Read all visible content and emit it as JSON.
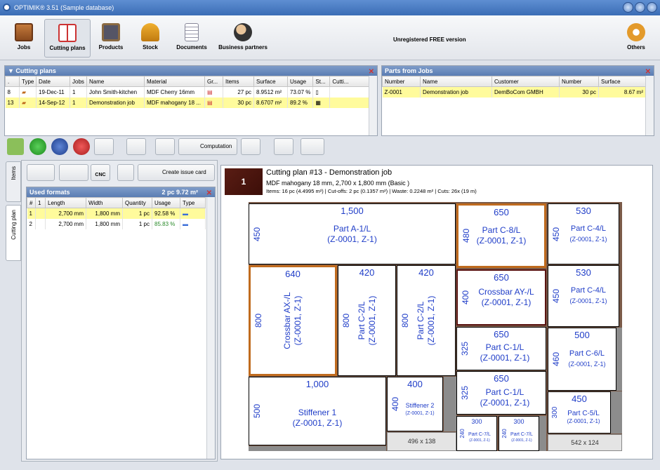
{
  "app": {
    "title": "OPTIMIK® 3.51 (Sample database)"
  },
  "toolbar": {
    "items": [
      {
        "label": "Jobs",
        "icon": "shelf-icon"
      },
      {
        "label": "Cutting plans",
        "icon": "cutting-plan-icon"
      },
      {
        "label": "Products",
        "icon": "cabinet-icon"
      },
      {
        "label": "Stock",
        "icon": "forklift-icon"
      },
      {
        "label": "Documents",
        "icon": "document-icon"
      },
      {
        "label": "Business partners",
        "icon": "people-icon"
      }
    ],
    "unregistered": "Unregistered FREE version",
    "others": "Others"
  },
  "cutting_plans": {
    "title": "Cutting plans",
    "headers": [
      ".",
      "Type",
      "Date",
      "Jobs",
      "Name",
      "Material",
      "Gr...",
      "Items",
      "Surface",
      "Usage",
      "St...",
      "Cutti..."
    ],
    "rows": [
      {
        "id": "8",
        "date": "19-Dec-11",
        "jobs": "1",
        "name": "John Smith-kitchen",
        "material": "MDF Cherry 16mm",
        "items": "27 pc",
        "surface": "8.9512 m²",
        "usage": "73.07 %"
      },
      {
        "id": "13",
        "date": "14-Sep-12",
        "jobs": "1",
        "name": "Demonstration job",
        "material": "MDF mahogany 18 ...",
        "items": "30 pc",
        "surface": "8.6707 m²",
        "usage": "89.2 %"
      }
    ]
  },
  "parts": {
    "title": "Parts from Jobs",
    "headers": [
      "Number",
      "Name",
      "Customer",
      "Number",
      "Surface"
    ],
    "rows": [
      {
        "number": "Z-0001",
        "name": "Demonstration job",
        "customer": "DemBoCom GMBH",
        "qty": "30 pc",
        "surface": "8.67 m²"
      }
    ]
  },
  "actions": {
    "computation": "Computation",
    "create_issue": "Create issue card",
    "cnc": "CNC"
  },
  "tabs": {
    "items": "Items",
    "cutting_plan": "Cutting plan"
  },
  "used_formats": {
    "title": "Used formats",
    "summary": "2 pc   9.72 m²",
    "headers": [
      "#",
      "1",
      "Length",
      "Width",
      "Quantity",
      "Usage",
      "Type"
    ],
    "rows": [
      {
        "n": "1",
        "length": "2,700 mm",
        "width": "1,800 mm",
        "qty": "1 pc",
        "usage": "92.58 %"
      },
      {
        "n": "2",
        "length": "2,700 mm",
        "width": "1,800 mm",
        "qty": "1 pc",
        "usage": "85.83 %"
      }
    ]
  },
  "plan": {
    "number": "1",
    "title": "Cutting plan #13 - Demonstration job",
    "material": "MDF mahogany 18 mm, 2,700 x 1,800 mm (Basic  )",
    "stats": "Items: 16 pc (4.4995 m²)  |  Cut-offs: 2 pc (0.1357 m²)  |  Waste: 0.2248 m²  |  Cuts: 26x  (19 m)",
    "pieces": [
      {
        "w": "1,500",
        "h": "450",
        "name": "Part A-1/L",
        "code": "(Z-0001, Z-1)"
      },
      {
        "w": "650",
        "h": "480",
        "name": "Part C-8/L",
        "code": "(Z-0001, Z-1)"
      },
      {
        "w": "530",
        "h": "450",
        "name": "Part C-4/L",
        "code": "(Z-0001, Z-1)"
      },
      {
        "w": "640",
        "h": "800",
        "name": "Crossbar AX-/L",
        "code": "(Z-0001, Z-1)"
      },
      {
        "w": "420",
        "h": "800",
        "name": "Part C-2/L",
        "code": "(Z-0001, Z-1)"
      },
      {
        "w": "420",
        "h": "800",
        "name": "Part C-2/L",
        "code": "(Z-0001, Z-1)"
      },
      {
        "w": "650",
        "h": "400",
        "name": "Crossbar AY-/L",
        "code": "(Z-0001, Z-1)"
      },
      {
        "w": "530",
        "h": "450",
        "name": "Part C-4/L",
        "code": "(Z-0001, Z-1)"
      },
      {
        "w": "650",
        "h": "325",
        "name": "Part C-1/L",
        "code": "(Z-0001, Z-1)"
      },
      {
        "w": "500",
        "h": "460",
        "name": "Part C-6/L",
        "code": "(Z-0001, Z-1)"
      },
      {
        "w": "1,000",
        "h": "500",
        "name": "Stiffener 1",
        "code": "(Z-0001, Z-1)"
      },
      {
        "w": "400",
        "h": "400",
        "name": "Stiffener 2",
        "code": "(Z-0001, Z-1)"
      },
      {
        "w": "650",
        "h": "325",
        "name": "Part C-1/L",
        "code": "(Z-0001, Z-1)"
      },
      {
        "w": "450",
        "h": "300",
        "name": "Part C-5/L",
        "code": "(Z-0001, Z-1)"
      },
      {
        "w": "300",
        "h": "240",
        "name": "Part C-7/L",
        "code": "(Z-0001, Z-1)"
      },
      {
        "w": "300",
        "h": "240",
        "name": "Part C-7/L",
        "code": "(Z-0001, Z-1)"
      }
    ],
    "offcuts": [
      "496 x 138",
      "542 x 124"
    ]
  }
}
